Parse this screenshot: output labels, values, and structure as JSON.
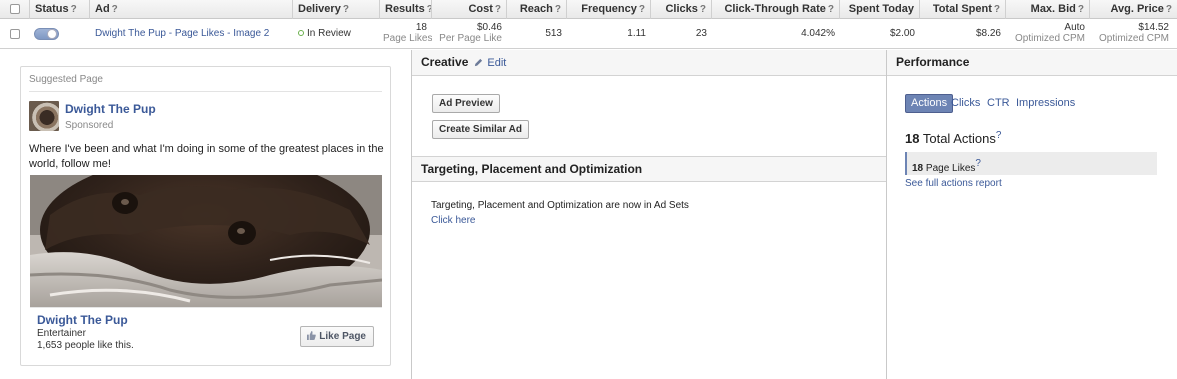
{
  "table": {
    "headers": {
      "status": "Status",
      "ad": "Ad",
      "delivery": "Delivery",
      "results": "Results",
      "cost": "Cost",
      "reach": "Reach",
      "frequency": "Frequency",
      "clicks": "Clicks",
      "ctr": "Click-Through Rate",
      "spent_today": "Spent Today",
      "total_spent": "Total Spent",
      "max_bid": "Max. Bid",
      "avg_price": "Avg. Price"
    },
    "help_glyph": "?",
    "row": {
      "ad_name": "Dwight The Pup - Page Likes - Image 2",
      "delivery": "In Review",
      "results_value": "18",
      "results_unit": "Page Likes",
      "cost_value": "$0.46",
      "cost_unit": "Per Page Like",
      "reach": "513",
      "frequency": "1.11",
      "clicks": "23",
      "ctr": "4.042%",
      "spent_today": "$2.00",
      "total_spent": "$8.26",
      "max_bid_value": "Auto",
      "max_bid_unit": "Optimized CPM",
      "avg_price_value": "$14.52",
      "avg_price_unit": "Optimized CPM",
      "toggle_on": true
    }
  },
  "preview": {
    "header": "Suggested Page",
    "page_name": "Dwight The Pup",
    "sponsored": "Sponsored",
    "message": "Where I've been and what I'm doing in some of the greatest places in the world, follow me!",
    "footer_name": "Dwight The Pup",
    "category": "Entertainer",
    "likes": "1,653 people like this.",
    "like_button": "Like Page"
  },
  "creative": {
    "title": "Creative",
    "edit": "Edit",
    "ad_preview_button": "Ad Preview",
    "create_similar_button": "Create Similar Ad"
  },
  "targeting": {
    "title": "Targeting, Placement and Optimization",
    "notice": "Targeting, Placement and Optimization are now in Ad Sets",
    "link": "Click here"
  },
  "performance": {
    "title": "Performance",
    "tabs": [
      "Actions",
      "Clicks",
      "CTR",
      "Impressions"
    ],
    "active_tab": "Actions",
    "total_count": "18",
    "total_label": "Total Actions",
    "metric_count": "18",
    "metric_label": "Page Likes",
    "report_link": "See full actions report"
  },
  "colors": {
    "link": "#3b5998",
    "active_tab": "#6d84b4",
    "in_review_dot": "#6ab04c"
  }
}
